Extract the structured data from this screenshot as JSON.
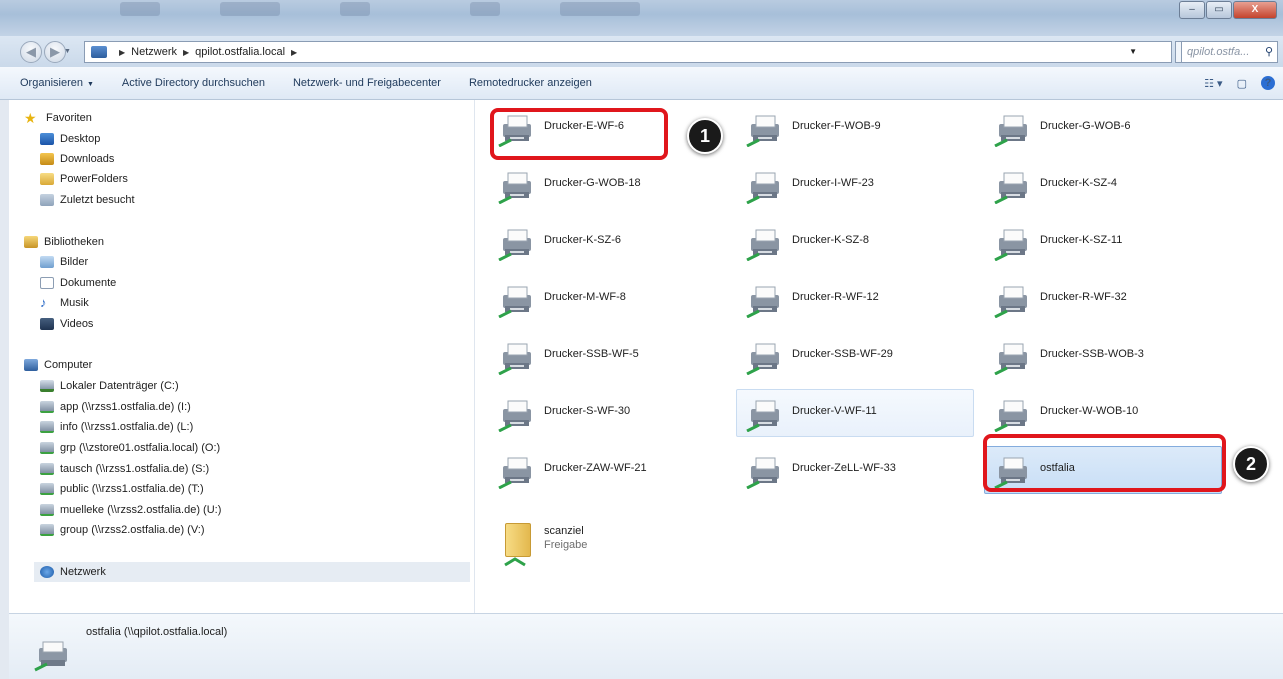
{
  "window": {
    "min_label": "–",
    "max_label": "▭",
    "close_label": "X"
  },
  "address": {
    "crumbs": [
      "Netzwerk",
      "qpilot.ostfalia.local"
    ],
    "search_placeholder": "qpilot.ostfa...",
    "refresh_label": "↻"
  },
  "toolbar": {
    "organize": "Organisieren",
    "ad_search": "Active Directory durchsuchen",
    "network_center": "Netzwerk- und Freigabecenter",
    "remote_printers": "Remotedrucker anzeigen"
  },
  "nav": {
    "favorites": "Favoriten",
    "desktop": "Desktop",
    "downloads": "Downloads",
    "powerfolders": "PowerFolders",
    "recent": "Zuletzt besucht",
    "libraries": "Bibliotheken",
    "pictures": "Bilder",
    "documents": "Dokumente",
    "music": "Musik",
    "videos": "Videos",
    "computer": "Computer",
    "drives": [
      "Lokaler Datenträger (C:)",
      "app (\\\\rzss1.ostfalia.de) (I:)",
      "info (\\\\rzss1.ostfalia.de) (L:)",
      "grp (\\\\zstore01.ostfalia.local) (O:)",
      "tausch (\\\\rzss1.ostfalia.de) (S:)",
      "public (\\\\rzss1.ostfalia.de) (T:)",
      "muelleke (\\\\rzss2.ostfalia.de) (U:)",
      "group (\\\\rzss2.ostfalia.de) (V:)"
    ],
    "network": "Netzwerk"
  },
  "items": [
    "Drucker-E-WF-6",
    "Drucker-F-WOB-9",
    "Drucker-G-WOB-6",
    "Drucker-G-WOB-18",
    "Drucker-I-WF-23",
    "Drucker-K-SZ-4",
    "Drucker-K-SZ-6",
    "Drucker-K-SZ-8",
    "Drucker-K-SZ-11",
    "Drucker-M-WF-8",
    "Drucker-R-WF-12",
    "Drucker-R-WF-32",
    "Drucker-SSB-WF-5",
    "Drucker-SSB-WF-29",
    "Drucker-SSB-WOB-3",
    "Drucker-S-WF-30",
    "Drucker-V-WF-11",
    "Drucker-W-WOB-10",
    "Drucker-ZAW-WF-21",
    "Drucker-ZeLL-WF-33",
    "ostfalia"
  ],
  "folder_item": {
    "name": "scanziel",
    "sub": "Freigabe"
  },
  "callouts": [
    "1",
    "2"
  ],
  "details": {
    "text": "ostfalia (\\\\qpilot.ostfalia.local)"
  }
}
